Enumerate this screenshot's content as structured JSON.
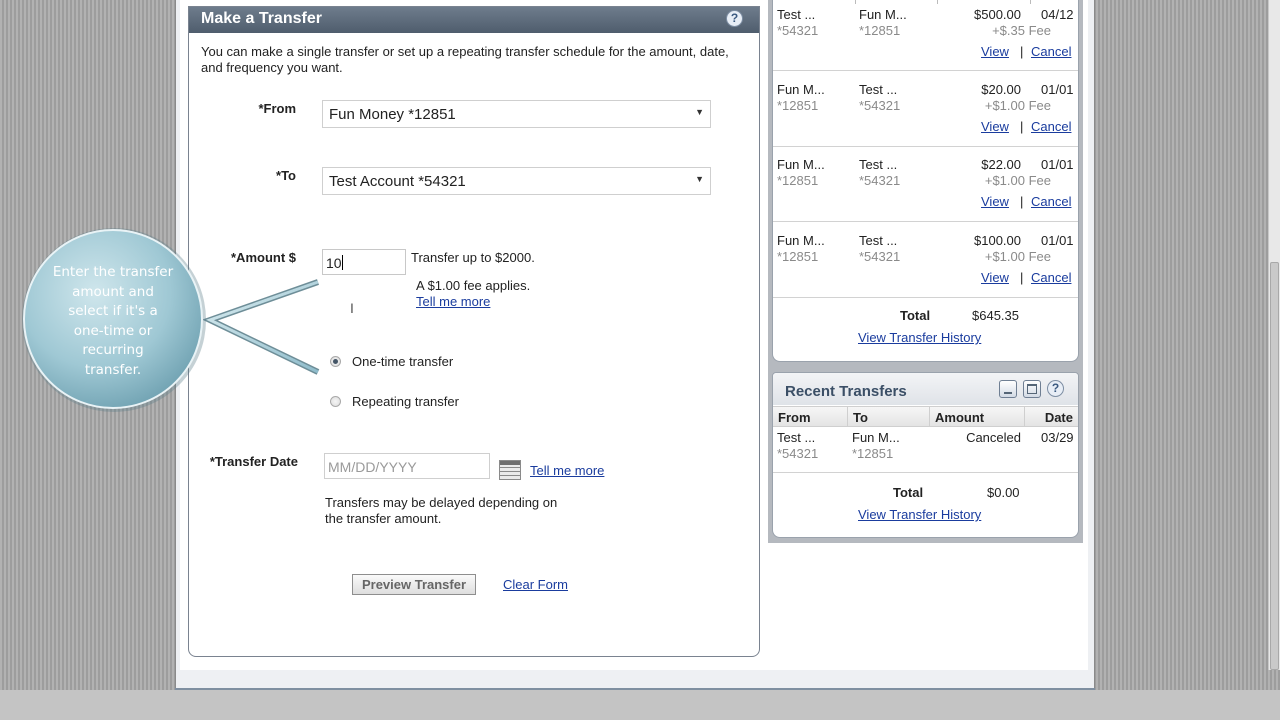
{
  "transfer": {
    "title": "Make a Transfer",
    "help_glyph": "?",
    "intro": "You can make a single transfer or set up a repeating transfer schedule for the amount, date, and frequency you want.",
    "from_label": "*From",
    "from_value": "Fun Money *12851",
    "to_label": "*To",
    "to_value": "Test Account *54321",
    "amount_label": "*Amount $",
    "amount_value": "10",
    "limit_text": "Transfer up to $2000.",
    "fee_text": "A $1.00 fee applies.",
    "tell_me_more": "Tell me more",
    "one_time_label": "One-time transfer",
    "repeating_label": "Repeating transfer",
    "selected_type": "One-time transfer",
    "date_label": "*Transfer Date",
    "date_placeholder": "MM/DD/YYYY",
    "date_note": "Transfers may be delayed depending on the transfer amount.",
    "preview_label": "Preview Transfer",
    "clear_label": "Clear Form"
  },
  "scheduled": {
    "rows": [
      {
        "from": "Test ...",
        "from_acct": "*54321",
        "to": "Fun M...",
        "to_acct": "*12851",
        "amount": "$500.00",
        "fee": "+$.35 Fee",
        "date": "04/12",
        "view": "View ",
        "cancel": "Cancel"
      },
      {
        "from": "Fun M...",
        "from_acct": "*12851",
        "to": "Test ...",
        "to_acct": "*54321",
        "amount": "$20.00",
        "fee": "+$1.00 Fee",
        "date": "01/01",
        "view": "View ",
        "cancel": "Cancel"
      },
      {
        "from": "Fun M...",
        "from_acct": "*12851",
        "to": "Test ...",
        "to_acct": "*54321",
        "amount": "$22.00",
        "fee": "+$1.00 Fee",
        "date": "01/01",
        "view": "View ",
        "cancel": "Cancel"
      },
      {
        "from": "Fun M...",
        "from_acct": "*12851",
        "to": "Test ...",
        "to_acct": "*54321",
        "amount": "$100.00",
        "fee": "+$1.00 Fee",
        "date": "01/01",
        "view": "View ",
        "cancel": "Cancel"
      }
    ],
    "link_separator": "|",
    "total_label": "Total",
    "total_value": "$645.35",
    "history_link": "View Transfer History"
  },
  "recent": {
    "title": "Recent Transfers",
    "columns": [
      "From",
      "To",
      "Amount",
      "Date"
    ],
    "rows": [
      {
        "from": "Test ...",
        "from_acct": "*54321",
        "to": "Fun M...",
        "to_acct": "*12851",
        "amount": "Canceled",
        "date": "03/29"
      }
    ],
    "total_label": "Total",
    "total_value": "$0.00",
    "history_link": "View Transfer History"
  },
  "callout": {
    "lines": [
      "Enter the transfer",
      "amount and",
      "select if it's a",
      "one-time or",
      "recurring",
      "transfer."
    ]
  },
  "icons": {
    "help": "help-icon",
    "calendar": "calendar-icon",
    "dropdown": "chevron-down-icon",
    "minimize": "minimize-icon",
    "maximize": "maximize-icon"
  },
  "colors": {
    "header_bar": "#5d6b7b",
    "link": "#1a3c9e",
    "callout_fill": "#9fc8d4"
  }
}
